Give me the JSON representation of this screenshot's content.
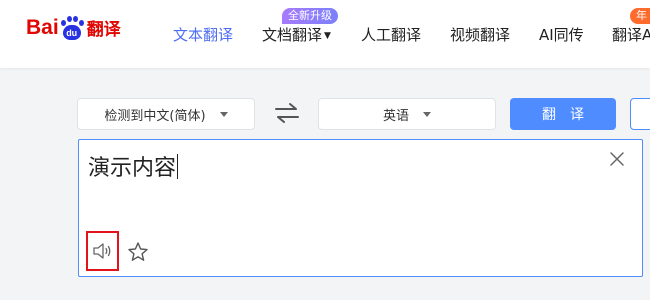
{
  "logo": {
    "bai": "Bai",
    "du": "du",
    "fanyi": "翻译"
  },
  "nav": {
    "items": [
      {
        "label": "文本翻译",
        "active": true
      },
      {
        "label": "文档翻译",
        "caret": "▼",
        "badge": "全新升级"
      },
      {
        "label": "人工翻译"
      },
      {
        "label": "视频翻译"
      },
      {
        "label": "AI同传"
      },
      {
        "label": "翻译A",
        "badge": "年"
      }
    ]
  },
  "toolbar": {
    "source_lang": "检测到中文(简体)",
    "target_lang": "英语",
    "translate_label": "翻译"
  },
  "input": {
    "text": "演示内容"
  },
  "colors": {
    "accent": "#4e8cff",
    "active_nav": "#4e6ef2",
    "highlight_border": "#e3131b",
    "brand_red": "#e10602",
    "brand_blue": "#2932e1"
  }
}
